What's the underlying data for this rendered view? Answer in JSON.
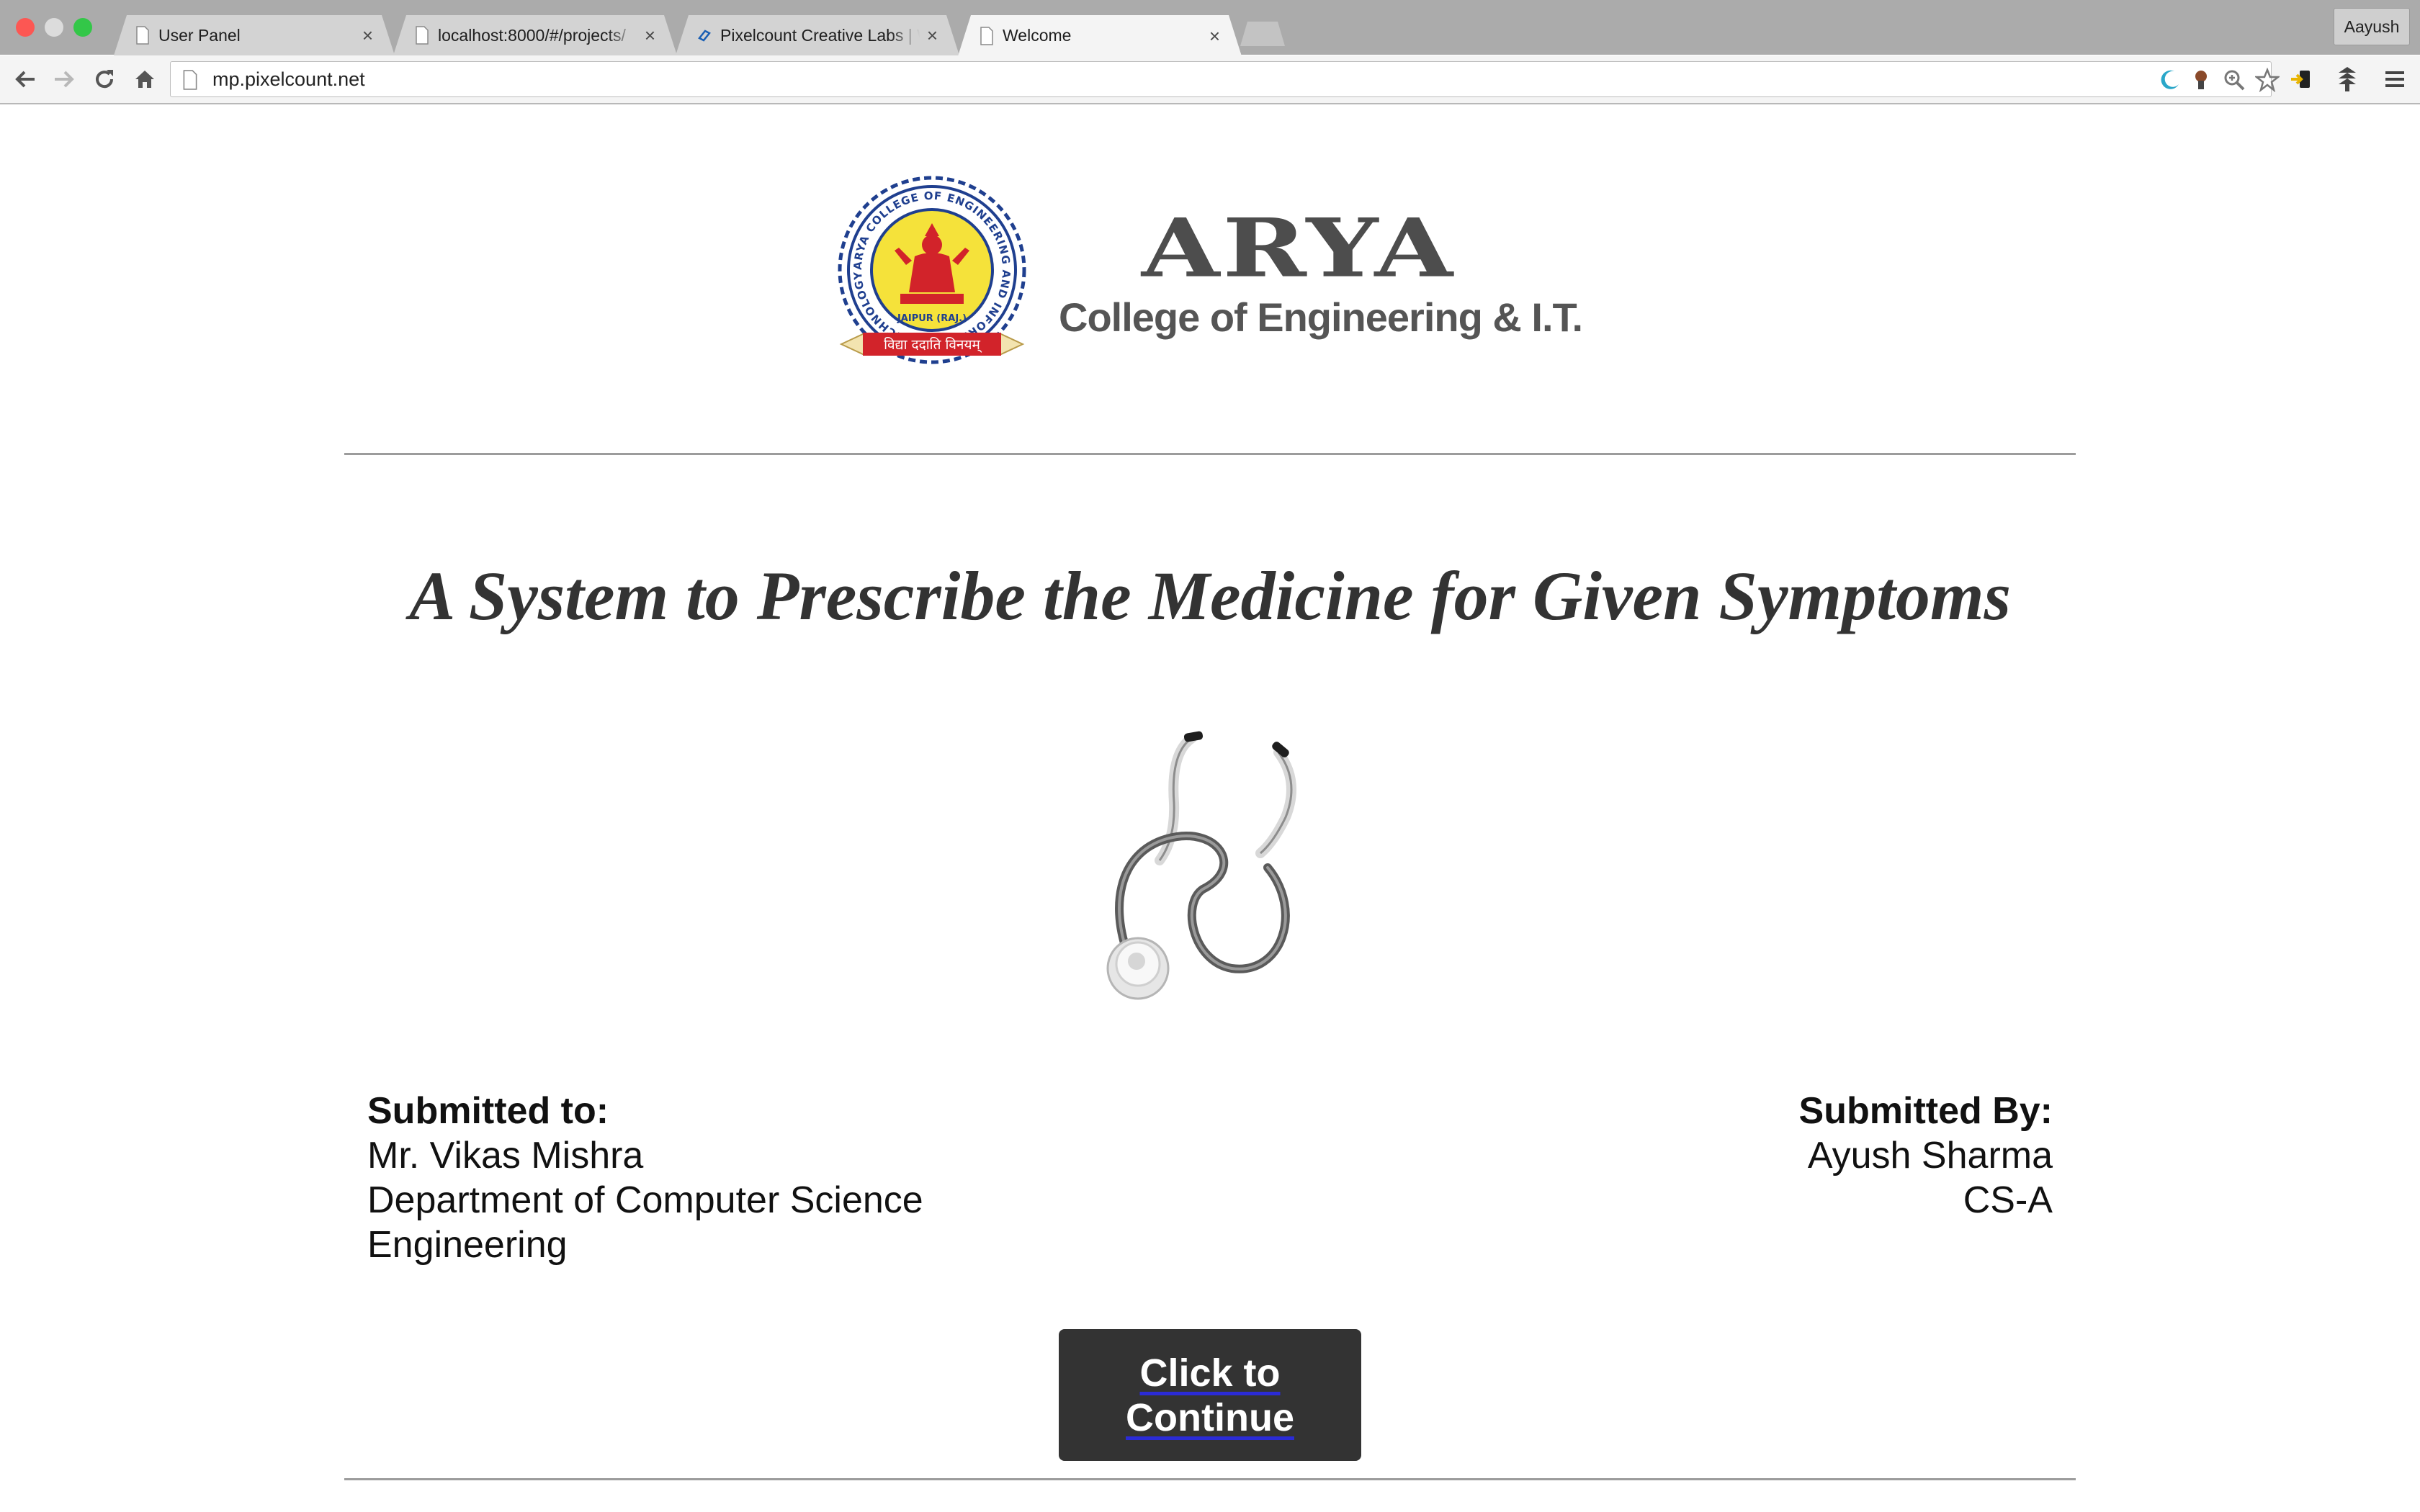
{
  "browser": {
    "tabs": [
      {
        "title": "User Panel",
        "active": false
      },
      {
        "title": "localhost:8000/#/projects/",
        "active": false
      },
      {
        "title": "Pixelcount Creative Labs | W",
        "active": false
      },
      {
        "title": "Welcome",
        "active": true
      }
    ],
    "tab_close_glyph": "×",
    "profile_name": "Aayush",
    "url": "mp.pixelcount.net",
    "colors": {
      "close_light": "#fc5753",
      "minimize_light": "#dcdcdc",
      "zoom_light": "#33c748"
    }
  },
  "logo": {
    "name": "ARYA",
    "subtitle": "College of Engineering & I.T.",
    "seal_ring_text": "ARYA COLLEGE OF ENGINEERING AND INFORMATION TECHNOLOGY",
    "seal_city": "JAIPUR (RAJ.)",
    "seal_motto": "विद्या ददाति विनयम्",
    "colors": {
      "seal_ring": "#1f3f8f",
      "seal_center": "#f5e23a",
      "ribbon": "#d2232a"
    }
  },
  "project": {
    "title": "A System to Prescribe the Medicine for Given Symptoms"
  },
  "submitted_to": {
    "heading": "Submitted to:",
    "name": "Mr. Vikas Mishra",
    "department_line1": "Department of Computer Science",
    "department_line2": "Engineering"
  },
  "submitted_by": {
    "heading": "Submitted By:",
    "name": "Ayush Sharma",
    "class": "CS-A"
  },
  "continue_button": {
    "label": "Click to Continue"
  }
}
